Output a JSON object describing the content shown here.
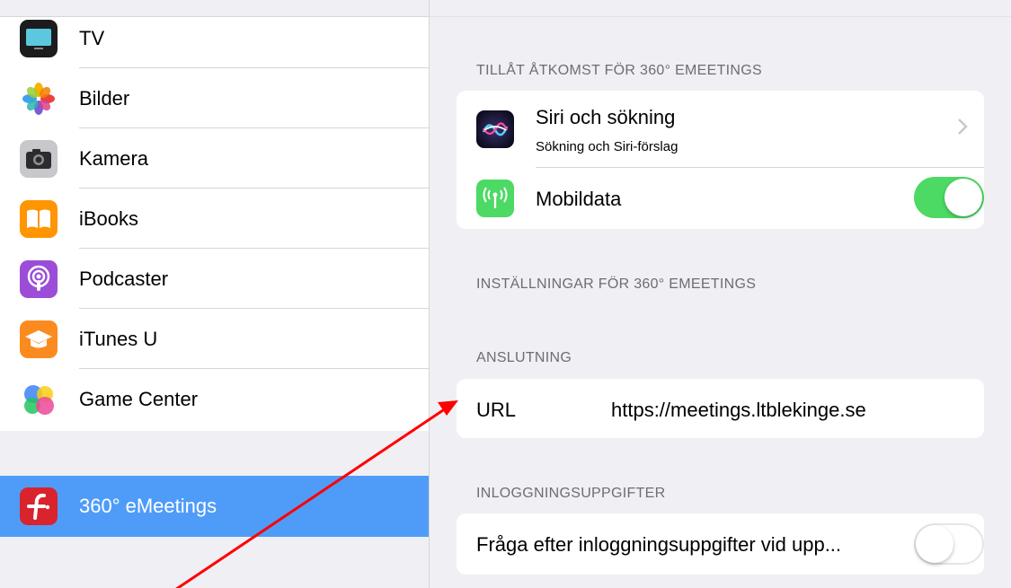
{
  "sidebar": {
    "items": [
      {
        "label": "TV",
        "icon": "tv-icon"
      },
      {
        "label": "Bilder",
        "icon": "photos-icon"
      },
      {
        "label": "Kamera",
        "icon": "camera-icon"
      },
      {
        "label": "iBooks",
        "icon": "ibooks-icon"
      },
      {
        "label": "Podcaster",
        "icon": "podcasts-icon"
      },
      {
        "label": "iTunes U",
        "icon": "itunes-u-icon"
      },
      {
        "label": "Game Center",
        "icon": "game-center-icon"
      }
    ],
    "selected": {
      "label": "360° eMeetings",
      "icon": "emeetings-app-icon"
    }
  },
  "access": {
    "header": "TILLÅT ÅTKOMST FÖR 360° EMEETINGS",
    "siri_title": "Siri och sökning",
    "siri_subtitle": "Sökning och Siri-förslag",
    "mobile_label": "Mobildata",
    "mobile_on": true
  },
  "settings_header": "INSTÄLLNINGAR FÖR 360° EMEETINGS",
  "connection": {
    "header": "ANSLUTNING",
    "url_label": "URL",
    "url_value": "https://meetings.ltblekinge.se"
  },
  "login": {
    "header": "INLOGGNINGSUPPGIFTER",
    "ask_label": "Fråga efter inloggningsuppgifter vid upp...",
    "ask_on": false
  },
  "colors": {
    "accent_selected": "#4f9cf8",
    "toggle_on": "#4cd964",
    "annotation_arrow": "#ff0000"
  }
}
